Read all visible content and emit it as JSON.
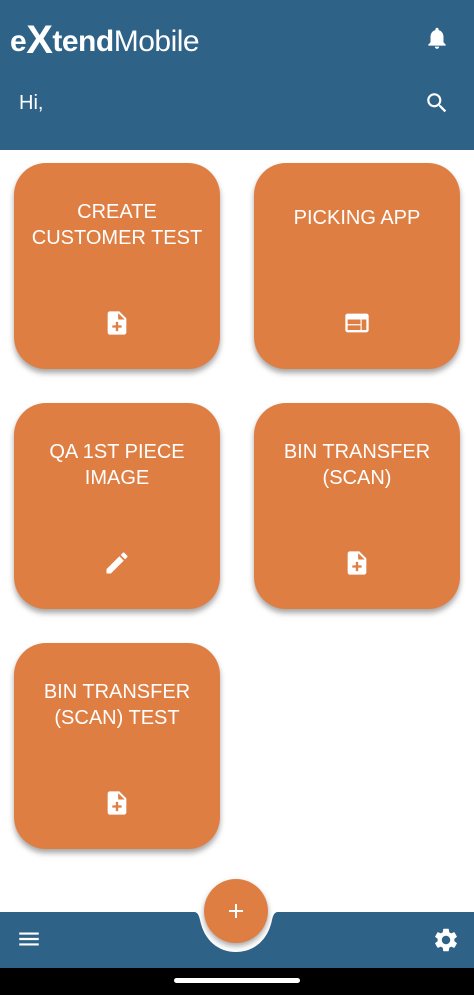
{
  "header": {
    "logo": {
      "part_e": "e",
      "part_x": "X",
      "part_tend": "tend",
      "part_mobile": "Mobile"
    },
    "greeting": "Hi,",
    "notification_icon": "bell-icon",
    "search_icon": "search-icon"
  },
  "tiles": [
    {
      "label": "CREATE CUSTOMER TEST",
      "icon": "file-add-icon"
    },
    {
      "label": "PICKING APP",
      "icon": "web-window-icon"
    },
    {
      "label": "QA 1ST PIECE IMAGE",
      "icon": "pencil-icon"
    },
    {
      "label": "BIN TRANSFER (SCAN)",
      "icon": "file-add-icon"
    },
    {
      "label": "BIN TRANSFER (SCAN) TEST",
      "icon": "file-add-icon"
    }
  ],
  "bottom_bar": {
    "menu_icon": "hamburger-menu-icon",
    "add_icon": "plus-icon",
    "settings_icon": "gear-icon"
  },
  "colors": {
    "header_bg": "#2e6287",
    "tile_bg": "#df7e42",
    "page_bg": "#ffffff",
    "bottom_bar_bg": "#2e6287"
  }
}
